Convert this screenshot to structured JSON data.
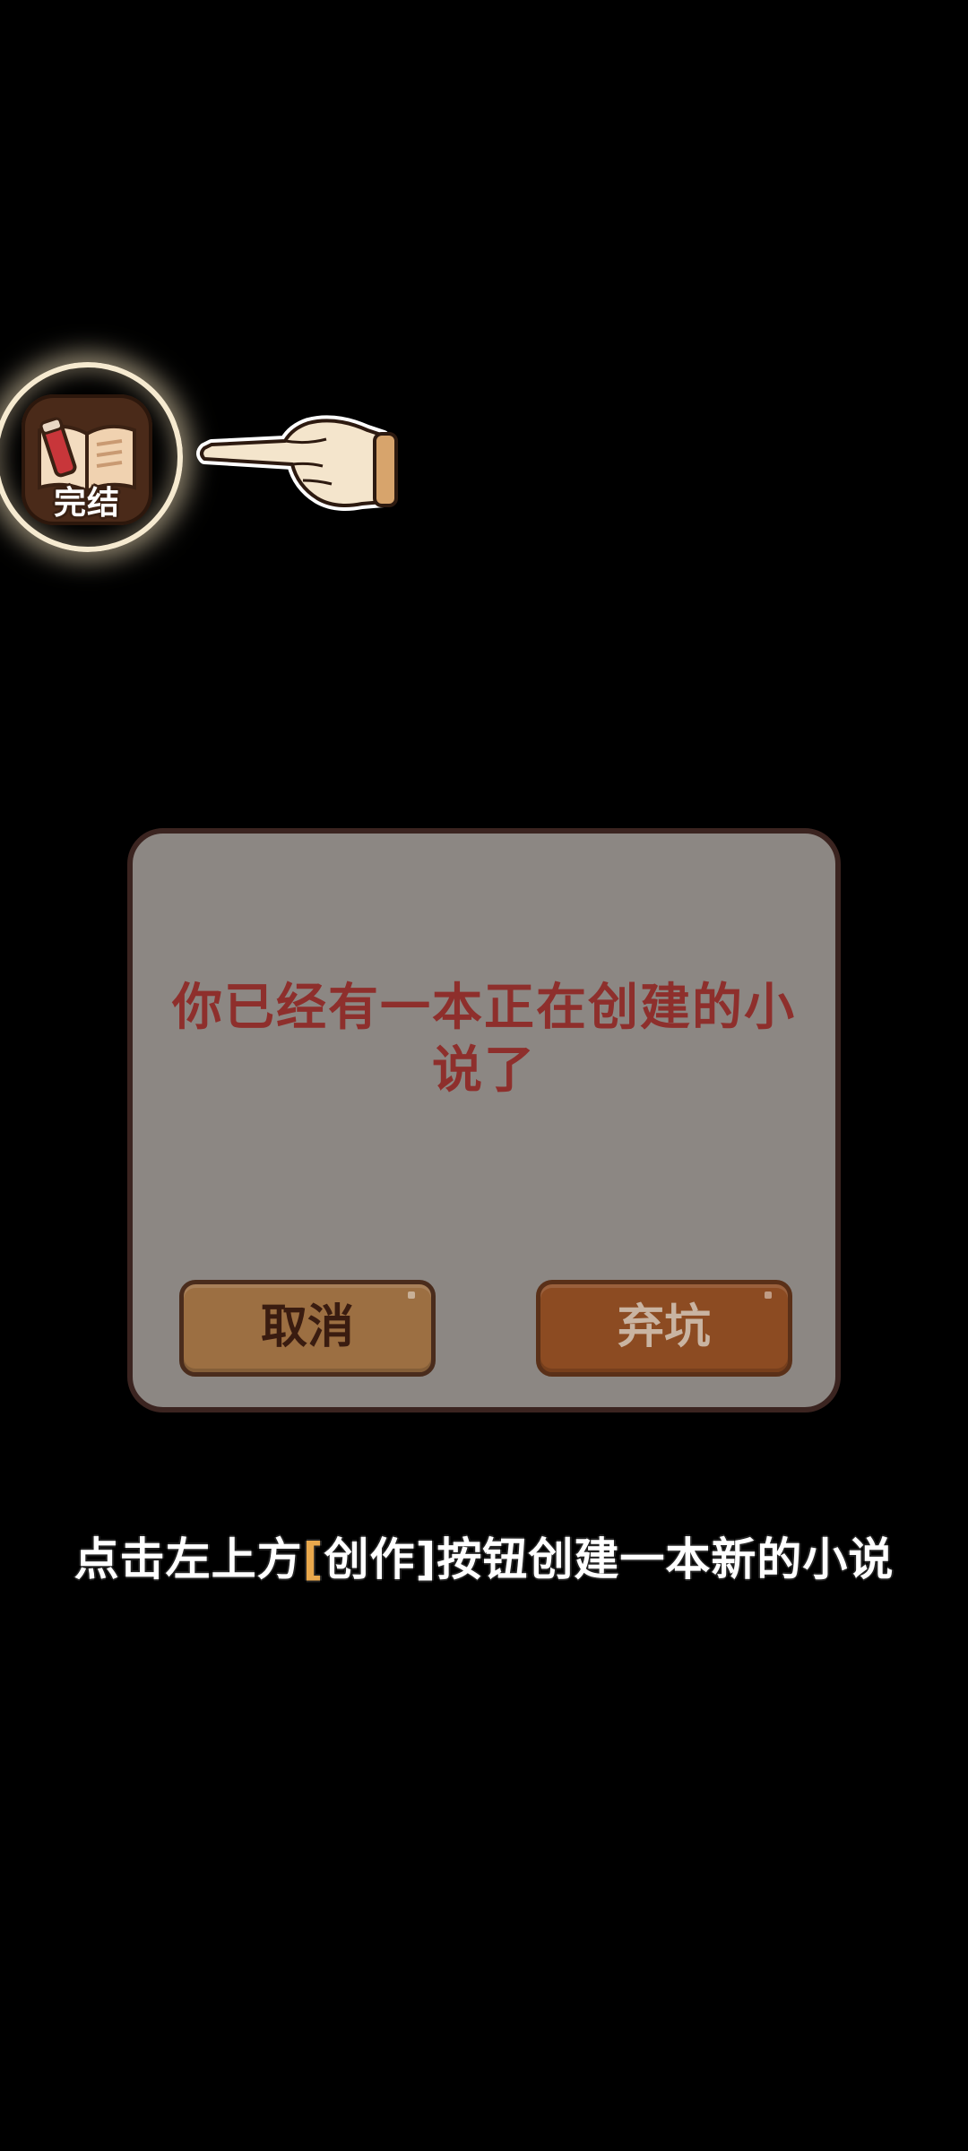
{
  "tutorial": {
    "highlighted_button": {
      "label": "完结",
      "icon": "open-book-icon"
    },
    "pointer_icon": "pointing-hand-icon",
    "hint": {
      "prefix": "点击左上方",
      "open_bracket": "[",
      "keyword": "创作",
      "close_bracket": "]",
      "suffix": "按钮创建一本新的小说"
    }
  },
  "dialog": {
    "message": "你已经有一本正在创建的小说了",
    "cancel_label": "取消",
    "abandon_label": "弃坑"
  },
  "colors": {
    "background": "#000000",
    "dialog_bg": "#8c8783",
    "dialog_text": "#8e2f2c",
    "cancel_button": "#9c6f42",
    "abandon_button": "#8c4b22",
    "bracket_accent": "#e9a84c"
  }
}
